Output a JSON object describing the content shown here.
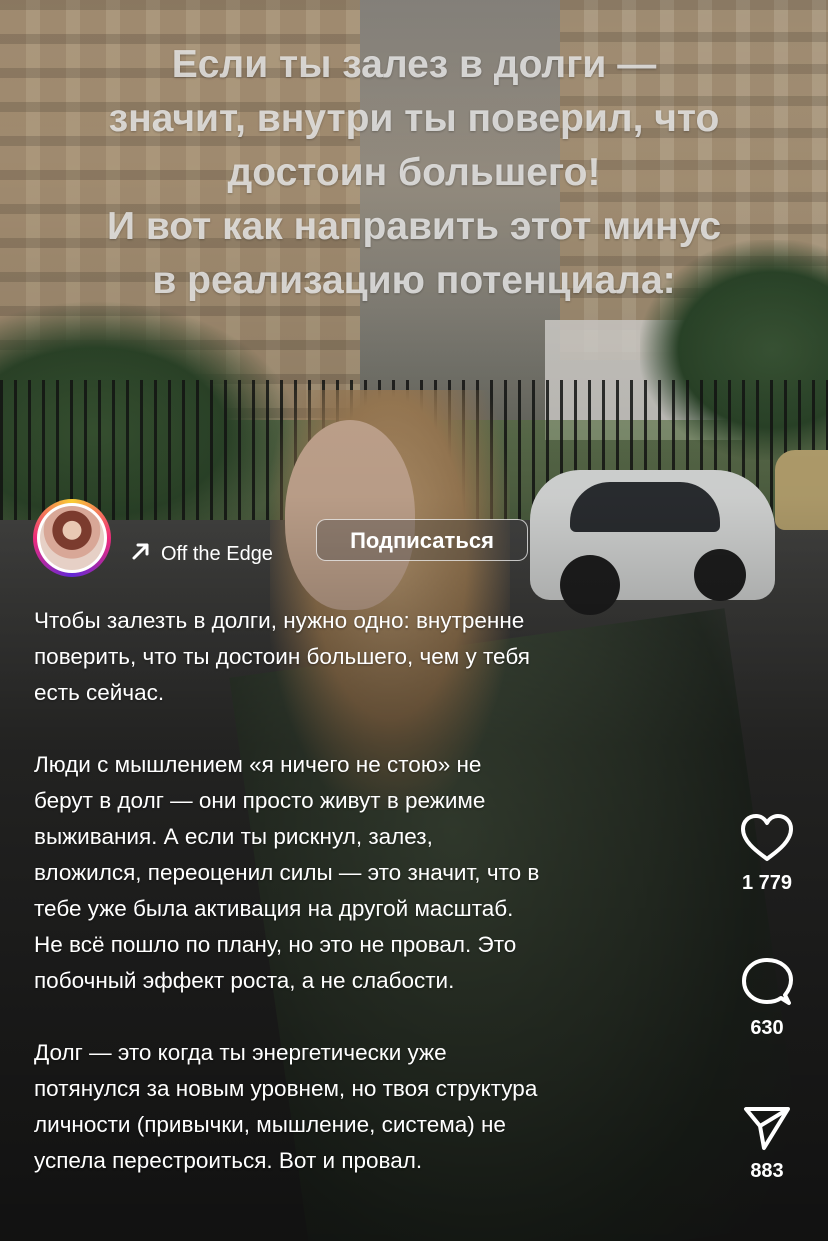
{
  "overlay": {
    "headline_lines": [
      "Если ты залез в долги —",
      "значит, внутри ты поверил, что",
      "достоин большего!",
      "И вот как направить этот минус",
      "в реализацию потенциала:"
    ]
  },
  "author": {
    "name": "Off the Edge",
    "follow_label": "Подписаться"
  },
  "caption": {
    "paragraphs": [
      [
        "Чтобы залезть в долги, нужно одно: внутренне",
        "поверить, что ты достоин большего, чем у тебя",
        "есть сейчас."
      ],
      [
        "Люди с мышлением «я ничего не стою» не",
        "берут в долг — они просто живут в режиме",
        "выживания. А если ты рискнул, залез,",
        "вложился, переоценил силы — это значит, что в",
        "тебе уже была активация на другой масштаб.",
        "Не всё пошло по плану, но это не провал. Это",
        "побочный эффект роста, а не слабости."
      ],
      [
        "Долг — это когда ты энергетически уже",
        "потянулся за новым уровнем, но твоя структура",
        "личности (привычки, мышление, система) не",
        "успела перестроиться. Вот и провал."
      ]
    ]
  },
  "actions": {
    "likes": "1 779",
    "comments": "630",
    "shares": "883"
  },
  "icons": {
    "like": "heart-icon",
    "comment": "comment-bubble-icon",
    "share": "send-paper-plane-icon",
    "link": "arrow-up-right-icon"
  }
}
